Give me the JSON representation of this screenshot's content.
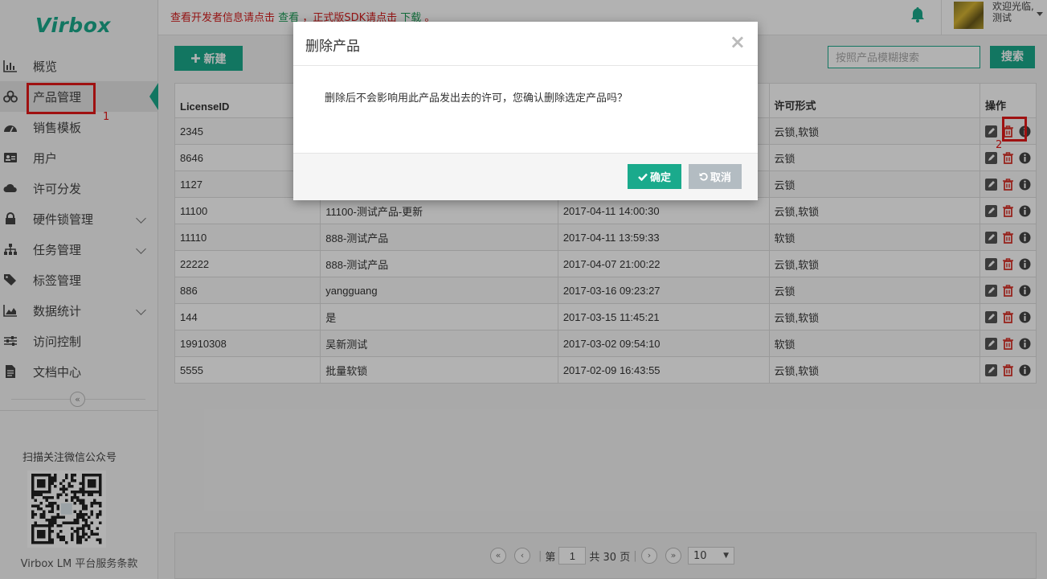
{
  "brand": {
    "logo": "Virbox"
  },
  "colors": {
    "accent": "#1aaa8c",
    "danger": "#e41919"
  },
  "sidebar": {
    "items": [
      {
        "label": "概览",
        "icon": "bar-chart-icon"
      },
      {
        "label": "产品管理",
        "icon": "cubes-icon",
        "active": true
      },
      {
        "label": "销售模板",
        "icon": "dashboard-icon"
      },
      {
        "label": "用户",
        "icon": "id-card-icon"
      },
      {
        "label": "许可分发",
        "icon": "cloud-icon"
      },
      {
        "label": "硬件锁管理",
        "icon": "lock-icon",
        "expandable": true
      },
      {
        "label": "任务管理",
        "icon": "sitemap-icon",
        "expandable": true
      },
      {
        "label": "标签管理",
        "icon": "tags-icon"
      },
      {
        "label": "数据统计",
        "icon": "area-chart-icon",
        "expandable": true
      },
      {
        "label": "访问控制",
        "icon": "sliders-icon"
      },
      {
        "label": "文档中心",
        "icon": "file-text-icon"
      }
    ],
    "collapse_glyph": "«",
    "qr_title": "扫描关注微信公众号",
    "terms": "Virbox LM 平台服务条款"
  },
  "annotations": {
    "step1": "1",
    "step2": "2"
  },
  "topbar": {
    "notice_part1": "查看开发者信息请点击",
    "notice_link1": "查看",
    "notice_part2": "，正式版SDK请点击",
    "notice_link2": "下载",
    "notice_end": "。",
    "welcome_line1": "欢迎光临,",
    "welcome_line2": "测试"
  },
  "toolbar": {
    "new_label": "新建",
    "search_placeholder": "按照产品模糊搜索",
    "search_label": "搜索"
  },
  "table": {
    "headers": [
      "LicenseID",
      "",
      "",
      "许可形式",
      "操作"
    ],
    "rows": [
      {
        "id": "2345",
        "name": "",
        "time": "",
        "form": "云锁,软锁"
      },
      {
        "id": "8646",
        "name": "",
        "time": "",
        "form": "云锁"
      },
      {
        "id": "1127",
        "name": "",
        "time": "",
        "form": "云锁"
      },
      {
        "id": "11100",
        "name": "11100-测试产品-更新",
        "time": "2017-04-11 14:00:30",
        "form": "云锁,软锁"
      },
      {
        "id": "11110",
        "name": "888-测试产品",
        "time": "2017-04-11 13:59:33",
        "form": "软锁"
      },
      {
        "id": "22222",
        "name": "888-测试产品",
        "time": "2017-04-07 21:00:22",
        "form": "云锁,软锁"
      },
      {
        "id": "886",
        "name": "yangguang",
        "time": "2017-03-16 09:23:27",
        "form": "云锁"
      },
      {
        "id": "144",
        "name": "是",
        "time": "2017-03-15 11:45:21",
        "form": "云锁,软锁"
      },
      {
        "id": "19910308",
        "name": "吴新测试",
        "time": "2017-03-02 09:54:10",
        "form": "软锁"
      },
      {
        "id": "5555",
        "name": "批量软锁",
        "time": "2017-02-09 16:43:55",
        "form": "云锁,软锁"
      }
    ]
  },
  "pagination": {
    "page_prefix": "第",
    "current_page": "1",
    "total_text": "共 30 页",
    "page_size": "10"
  },
  "modal": {
    "title": "删除产品",
    "close_glyph": "×",
    "message": "删除后不会影响用此产品发出去的许可，您确认删除选定产品吗？",
    "confirm_label": "确定",
    "cancel_label": "取消"
  }
}
